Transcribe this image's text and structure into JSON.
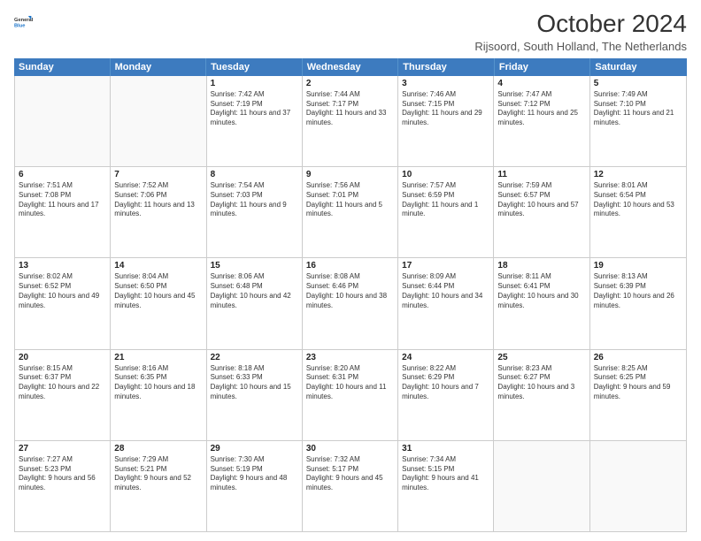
{
  "logo": {
    "line1": "General",
    "line2": "Blue"
  },
  "title": "October 2024",
  "subtitle": "Rijsoord, South Holland, The Netherlands",
  "header_days": [
    "Sunday",
    "Monday",
    "Tuesday",
    "Wednesday",
    "Thursday",
    "Friday",
    "Saturday"
  ],
  "weeks": [
    [
      {
        "day": "",
        "sunrise": "",
        "sunset": "",
        "daylight": "",
        "empty": true
      },
      {
        "day": "",
        "sunrise": "",
        "sunset": "",
        "daylight": "",
        "empty": true
      },
      {
        "day": "1",
        "sunrise": "Sunrise: 7:42 AM",
        "sunset": "Sunset: 7:19 PM",
        "daylight": "Daylight: 11 hours and 37 minutes."
      },
      {
        "day": "2",
        "sunrise": "Sunrise: 7:44 AM",
        "sunset": "Sunset: 7:17 PM",
        "daylight": "Daylight: 11 hours and 33 minutes."
      },
      {
        "day": "3",
        "sunrise": "Sunrise: 7:46 AM",
        "sunset": "Sunset: 7:15 PM",
        "daylight": "Daylight: 11 hours and 29 minutes."
      },
      {
        "day": "4",
        "sunrise": "Sunrise: 7:47 AM",
        "sunset": "Sunset: 7:12 PM",
        "daylight": "Daylight: 11 hours and 25 minutes."
      },
      {
        "day": "5",
        "sunrise": "Sunrise: 7:49 AM",
        "sunset": "Sunset: 7:10 PM",
        "daylight": "Daylight: 11 hours and 21 minutes."
      }
    ],
    [
      {
        "day": "6",
        "sunrise": "Sunrise: 7:51 AM",
        "sunset": "Sunset: 7:08 PM",
        "daylight": "Daylight: 11 hours and 17 minutes."
      },
      {
        "day": "7",
        "sunrise": "Sunrise: 7:52 AM",
        "sunset": "Sunset: 7:06 PM",
        "daylight": "Daylight: 11 hours and 13 minutes."
      },
      {
        "day": "8",
        "sunrise": "Sunrise: 7:54 AM",
        "sunset": "Sunset: 7:03 PM",
        "daylight": "Daylight: 11 hours and 9 minutes."
      },
      {
        "day": "9",
        "sunrise": "Sunrise: 7:56 AM",
        "sunset": "Sunset: 7:01 PM",
        "daylight": "Daylight: 11 hours and 5 minutes."
      },
      {
        "day": "10",
        "sunrise": "Sunrise: 7:57 AM",
        "sunset": "Sunset: 6:59 PM",
        "daylight": "Daylight: 11 hours and 1 minute."
      },
      {
        "day": "11",
        "sunrise": "Sunrise: 7:59 AM",
        "sunset": "Sunset: 6:57 PM",
        "daylight": "Daylight: 10 hours and 57 minutes."
      },
      {
        "day": "12",
        "sunrise": "Sunrise: 8:01 AM",
        "sunset": "Sunset: 6:54 PM",
        "daylight": "Daylight: 10 hours and 53 minutes."
      }
    ],
    [
      {
        "day": "13",
        "sunrise": "Sunrise: 8:02 AM",
        "sunset": "Sunset: 6:52 PM",
        "daylight": "Daylight: 10 hours and 49 minutes."
      },
      {
        "day": "14",
        "sunrise": "Sunrise: 8:04 AM",
        "sunset": "Sunset: 6:50 PM",
        "daylight": "Daylight: 10 hours and 45 minutes."
      },
      {
        "day": "15",
        "sunrise": "Sunrise: 8:06 AM",
        "sunset": "Sunset: 6:48 PM",
        "daylight": "Daylight: 10 hours and 42 minutes."
      },
      {
        "day": "16",
        "sunrise": "Sunrise: 8:08 AM",
        "sunset": "Sunset: 6:46 PM",
        "daylight": "Daylight: 10 hours and 38 minutes."
      },
      {
        "day": "17",
        "sunrise": "Sunrise: 8:09 AM",
        "sunset": "Sunset: 6:44 PM",
        "daylight": "Daylight: 10 hours and 34 minutes."
      },
      {
        "day": "18",
        "sunrise": "Sunrise: 8:11 AM",
        "sunset": "Sunset: 6:41 PM",
        "daylight": "Daylight: 10 hours and 30 minutes."
      },
      {
        "day": "19",
        "sunrise": "Sunrise: 8:13 AM",
        "sunset": "Sunset: 6:39 PM",
        "daylight": "Daylight: 10 hours and 26 minutes."
      }
    ],
    [
      {
        "day": "20",
        "sunrise": "Sunrise: 8:15 AM",
        "sunset": "Sunset: 6:37 PM",
        "daylight": "Daylight: 10 hours and 22 minutes."
      },
      {
        "day": "21",
        "sunrise": "Sunrise: 8:16 AM",
        "sunset": "Sunset: 6:35 PM",
        "daylight": "Daylight: 10 hours and 18 minutes."
      },
      {
        "day": "22",
        "sunrise": "Sunrise: 8:18 AM",
        "sunset": "Sunset: 6:33 PM",
        "daylight": "Daylight: 10 hours and 15 minutes."
      },
      {
        "day": "23",
        "sunrise": "Sunrise: 8:20 AM",
        "sunset": "Sunset: 6:31 PM",
        "daylight": "Daylight: 10 hours and 11 minutes."
      },
      {
        "day": "24",
        "sunrise": "Sunrise: 8:22 AM",
        "sunset": "Sunset: 6:29 PM",
        "daylight": "Daylight: 10 hours and 7 minutes."
      },
      {
        "day": "25",
        "sunrise": "Sunrise: 8:23 AM",
        "sunset": "Sunset: 6:27 PM",
        "daylight": "Daylight: 10 hours and 3 minutes."
      },
      {
        "day": "26",
        "sunrise": "Sunrise: 8:25 AM",
        "sunset": "Sunset: 6:25 PM",
        "daylight": "Daylight: 9 hours and 59 minutes."
      }
    ],
    [
      {
        "day": "27",
        "sunrise": "Sunrise: 7:27 AM",
        "sunset": "Sunset: 5:23 PM",
        "daylight": "Daylight: 9 hours and 56 minutes."
      },
      {
        "day": "28",
        "sunrise": "Sunrise: 7:29 AM",
        "sunset": "Sunset: 5:21 PM",
        "daylight": "Daylight: 9 hours and 52 minutes."
      },
      {
        "day": "29",
        "sunrise": "Sunrise: 7:30 AM",
        "sunset": "Sunset: 5:19 PM",
        "daylight": "Daylight: 9 hours and 48 minutes."
      },
      {
        "day": "30",
        "sunrise": "Sunrise: 7:32 AM",
        "sunset": "Sunset: 5:17 PM",
        "daylight": "Daylight: 9 hours and 45 minutes."
      },
      {
        "day": "31",
        "sunrise": "Sunrise: 7:34 AM",
        "sunset": "Sunset: 5:15 PM",
        "daylight": "Daylight: 9 hours and 41 minutes."
      },
      {
        "day": "",
        "sunrise": "",
        "sunset": "",
        "daylight": "",
        "empty": true
      },
      {
        "day": "",
        "sunrise": "",
        "sunset": "",
        "daylight": "",
        "empty": true
      }
    ]
  ]
}
